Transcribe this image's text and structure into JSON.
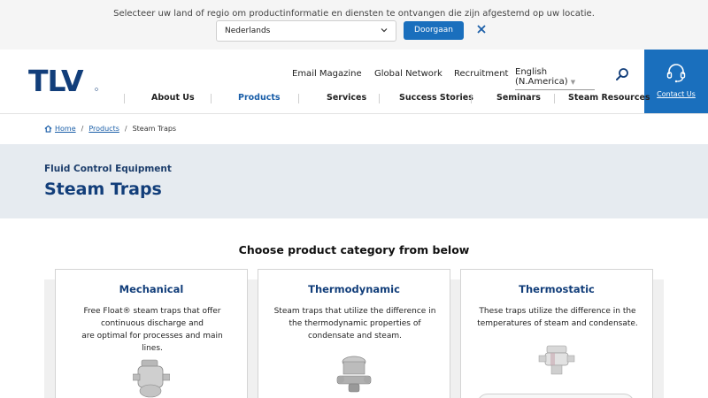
{
  "country_bar": {
    "message": "Selecteer uw land of regio om productinformatie en diensten te ontvangen die zijn afgestemd op uw locatie.",
    "selected_country": "Nederlands",
    "go_label": "Doorgaan"
  },
  "header": {
    "utility_links": [
      "Email Magazine",
      "Global Network",
      "Recruitment"
    ],
    "language": "English (N.America)",
    "contact_label": "Contact Us",
    "nav": [
      "About Us",
      "Products",
      "Services",
      "Success Stories",
      "Seminars",
      "Steam Resources"
    ],
    "active_nav": "Products",
    "brand_color": "#1a6fbd"
  },
  "breadcrumb": {
    "home": "Home",
    "products": "Products",
    "current": "Steam Traps"
  },
  "title_band": {
    "eyebrow": "Fluid Control Equipment",
    "title": "Steam Traps"
  },
  "categories": {
    "heading": "Choose product category from below",
    "items": [
      {
        "title": "Mechanical",
        "desc_lines": [
          "Free Float® steam traps that offer",
          "continuous discharge and",
          "are optimal for processes and main lines."
        ]
      },
      {
        "title": "Thermodynamic",
        "desc_lines": [
          "Steam traps that utilize the difference in",
          "the thermodynamic properties of",
          "condensate and steam."
        ]
      },
      {
        "title": "Thermostatic",
        "desc_lines": [
          "These traps utilize the difference in the",
          "temperatures of steam and condensate."
        ]
      }
    ]
  }
}
